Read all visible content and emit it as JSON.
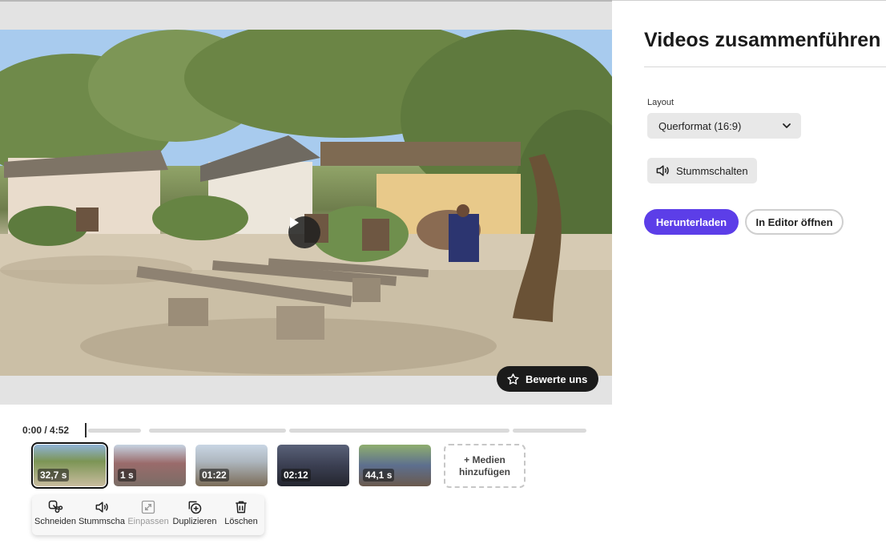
{
  "panel": {
    "title": "Videos zusammenführen",
    "layout_label": "Layout",
    "layout_value": "Querformat (16:9)",
    "mute_label": "Stummschalten",
    "download_label": "Herunterladen",
    "editor_label": "In Editor öffnen"
  },
  "preview": {
    "rate_label": "Bewerte uns",
    "play_icon": "play-icon"
  },
  "timeline": {
    "time": "0:00 / 4:52",
    "clips": [
      {
        "duration": "32,7 s",
        "selected": true
      },
      {
        "duration": "1 s",
        "selected": false
      },
      {
        "duration": "01:22",
        "selected": false
      },
      {
        "duration": "02:12",
        "selected": false
      },
      {
        "duration": "44,1 s",
        "selected": false
      }
    ],
    "add_media_line1": "+ Medien",
    "add_media_line2": "hinzufügen"
  },
  "clip_toolbar": {
    "items": [
      {
        "label": "Schneiden",
        "icon": "scissors-icon",
        "enabled": true
      },
      {
        "label": "Stummscha",
        "icon": "speaker-icon",
        "enabled": true
      },
      {
        "label": "Einpassen",
        "icon": "fit-icon",
        "enabled": false
      },
      {
        "label": "Duplizieren",
        "icon": "duplicate-icon",
        "enabled": true
      },
      {
        "label": "Löschen",
        "icon": "trash-icon",
        "enabled": true
      }
    ]
  },
  "colors": {
    "accent": "#5c3ee8",
    "dark_button": "#1b1b1b",
    "neutral_button": "#e8e8e8"
  }
}
